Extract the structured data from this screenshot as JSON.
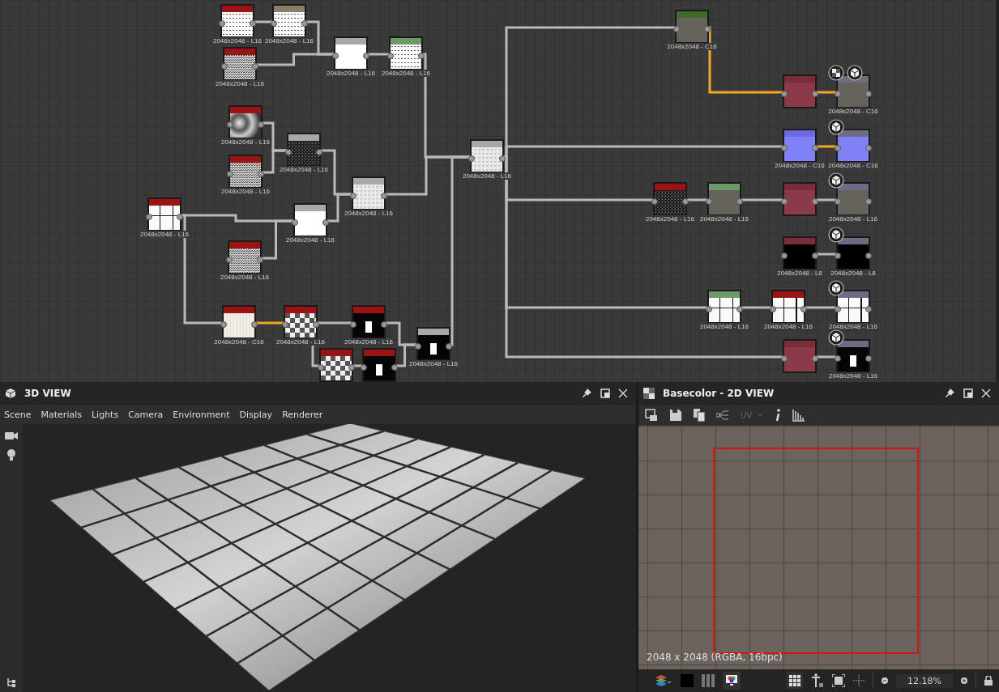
{
  "graph": {
    "nodes": [
      {
        "label": "2048x2048 - L16",
        "color": "#9c1316"
      },
      {
        "label": "2048x2048 - L16",
        "color": "#857f66"
      },
      {
        "label": "2048x2048 - L16",
        "color": "#9c1316"
      },
      {
        "label": "2048x2048 - L16",
        "color": "#a8a8a8"
      },
      {
        "label": "2048x2048 - L16",
        "color": "#6d9a6a"
      },
      {
        "label": "2048x2048 - L16",
        "color": "#9c1316"
      },
      {
        "label": "2048x2048 - L16",
        "color": "#9c1316"
      },
      {
        "label": "2048x2048 - L16",
        "color": "#a8a8a8"
      },
      {
        "label": "2048x2048 - L16",
        "color": "#a8a8a8"
      },
      {
        "label": "2048x2048 - L16",
        "color": "#9c1316"
      },
      {
        "label": "2048x2048 - L16",
        "color": "#a8a8a8"
      },
      {
        "label": "2048x2048 - L16",
        "color": "#9c1316"
      },
      {
        "label": "2048x2048 - L16",
        "color": "#a8a8a8"
      },
      {
        "label": "2048x2048 - C16",
        "color": "#9c1316"
      },
      {
        "label": "2048x2048 - L16",
        "color": "#9c1316"
      },
      {
        "label": "2048x2048 - L16",
        "color": "#9c1316"
      },
      {
        "color": "#9c1316"
      },
      {
        "color": "#9c1316"
      },
      {
        "label": "2048x2048 - L16",
        "color": "#a8a8a8"
      },
      {
        "label": "2048x2048 - C16",
        "color": "#3f6b2a"
      },
      {
        "color": "#7a2c38"
      },
      {
        "label": "2048x2048 - C16",
        "color": "#6e6c85"
      },
      {
        "label": "2048x2048 - C16",
        "color": "#6b6be0"
      },
      {
        "label": "2048x2048 - C16",
        "color": "#6e6c85"
      },
      {
        "label": "2048x2048 - L16",
        "color": "#9c1316"
      },
      {
        "label": "2048x2048 - L16",
        "color": "#6d9a6a"
      },
      {
        "color": "#7a2c38"
      },
      {
        "label": "2048x2048 - L16",
        "color": "#6e6c85"
      },
      {
        "label": "2048x2048 - L8",
        "color": "#7a2c38"
      },
      {
        "label": "2048x2048 - L8",
        "color": "#6e6c85"
      },
      {
        "label": "2048x2048 - L16",
        "color": "#6d9a6a"
      },
      {
        "label": "2048x2048 - L16",
        "color": "#9c1316"
      },
      {
        "label": "2048x2048 - L16",
        "color": "#6e6c85"
      },
      {
        "color": "#7a2c38"
      },
      {
        "label": "2048x2048 - L16",
        "color": "#6e6c85"
      }
    ]
  },
  "view_3d": {
    "title": "3D VIEW",
    "menu": [
      "Scene",
      "Materials",
      "Lights",
      "Camera",
      "Environment",
      "Display",
      "Renderer"
    ]
  },
  "view_2d": {
    "title": "Basecolor - 2D VIEW",
    "uv": {
      "label": "UV",
      "disabled": true
    },
    "resolution": "2048 x 2048 (RGBA, 16bpc)",
    "zoom": "12.18%"
  }
}
